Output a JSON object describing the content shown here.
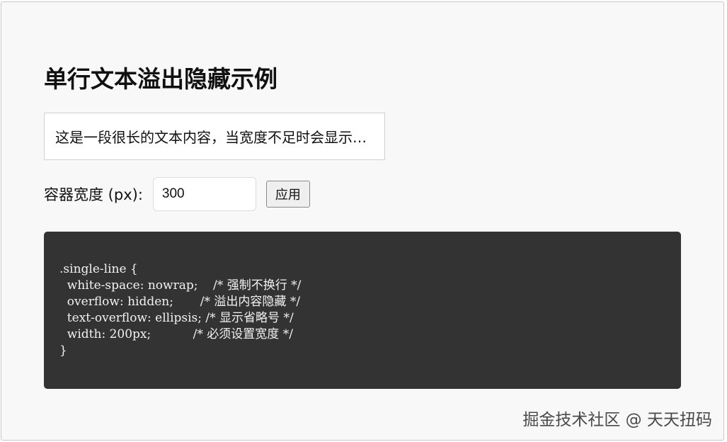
{
  "page": {
    "title": "单行文本溢出隐藏示例",
    "demo_text": "这是一段很长的文本内容，当宽度不足时会显示省略号，超出部分将被隐藏不再显示"
  },
  "controls": {
    "width_label": "容器宽度 (px):",
    "width_value": "300",
    "apply_label": "应用"
  },
  "code": {
    "lines": [
      ".single-line {",
      "  white-space: nowrap;    /* 强制不换行 */",
      "  overflow: hidden;       /* 溢出内容隐藏 */",
      "  text-overflow: ellipsis; /* 显示省略号 */",
      "  width: 200px;           /* 必须设置宽度 */",
      "}"
    ]
  },
  "watermark": "掘金技术社区 @ 天天扭码",
  "colors": {
    "page_background": "#f8f8f8",
    "code_background": "#333333",
    "code_text": "#f2f2f2"
  }
}
